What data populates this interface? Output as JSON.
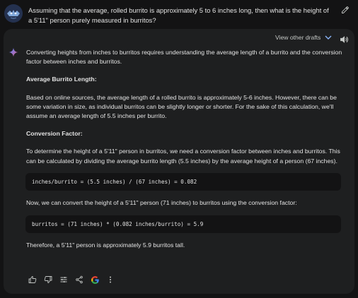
{
  "prompt": {
    "text": "Assuming that the average, rolled burrito is approximately 5 to 6 inches long, then what is the height of a 5'11\" person purely measured in burritos?"
  },
  "response_header": {
    "view_drafts_label": "View other drafts"
  },
  "answer": {
    "intro": "Converting heights from inches to burritos requires understanding the average length of a burrito and the conversion factor between inches and burritos.",
    "heading_1": "Average Burrito Length:",
    "para_1": "Based on online sources, the average length of a rolled burrito is approximately 5-6 inches. However, there can be some variation in size, as individual burritos can be slightly longer or shorter. For the sake of this calculation, we'll assume an average length of 5.5 inches per burrito.",
    "heading_2": "Conversion Factor:",
    "para_2": "To determine the height of a 5'11\" person in burritos, we need a conversion factor between inches and burritos. This can be calculated by dividing the average burrito length (5.5 inches) by the average height of a person (67 inches).",
    "code_1": "inches/burrito = (5.5 inches) / (67 inches) = 0.082",
    "para_3": "Now, we can convert the height of a 5'11\" person (71 inches) to burritos using the conversion factor:",
    "code_2": "burritos = (71 inches) * (0.082 inches/burrito) = 5.9",
    "conclusion": "Therefore, a 5'11\" person is approximately 5.9 burritos tall."
  },
  "icons": {
    "edit": "pencil-icon",
    "drafts_toggle": "chevron-down-icon",
    "speaker": "speaker-icon",
    "sparkle": "sparkle-icon",
    "actions": [
      "thumb-up-icon",
      "thumb-down-icon",
      "tune-icon",
      "share-icon",
      "google-icon",
      "more-vert-icon"
    ]
  },
  "colors": {
    "background": "#131314",
    "card": "#1e1f20",
    "accent_blue": "#8ab4f8"
  }
}
